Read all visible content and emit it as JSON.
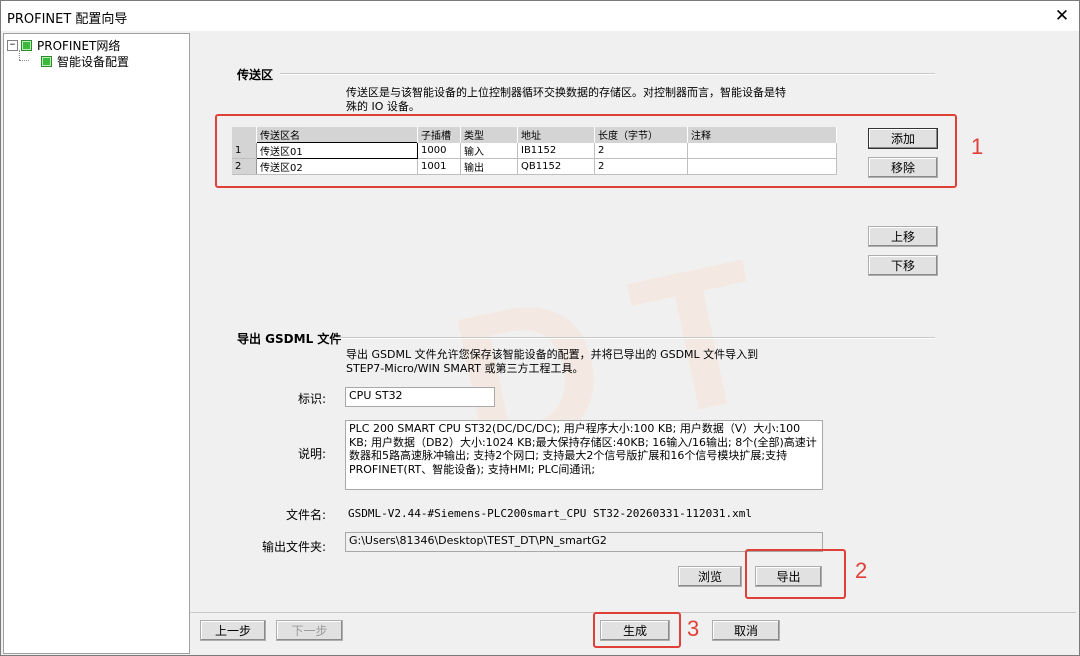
{
  "window": {
    "title": "PROFINET 配置向导",
    "close": "✕"
  },
  "tree": {
    "root": {
      "expander": "−",
      "label": "PROFINET网络"
    },
    "child": {
      "label": "智能设备配置"
    }
  },
  "transfer": {
    "title": "传送区",
    "description_line1": "传送区是与该智能设备的上位控制器循环交换数据的存储区。对控制器而言，智能设备是特",
    "description_line2": "殊的 IO 设备。",
    "columns": [
      "传送区名",
      "子插槽",
      "类型",
      "地址",
      "长度（字节）",
      "注释"
    ],
    "rows": [
      {
        "n": "1",
        "name": "传送区01",
        "slot": "1000",
        "type": "输入",
        "addr": "IB1152",
        "len": "2",
        "note": ""
      },
      {
        "n": "2",
        "name": "传送区02",
        "slot": "1001",
        "type": "输出",
        "addr": "QB1152",
        "len": "2",
        "note": ""
      }
    ],
    "add_label": "添加",
    "remove_label": "移除",
    "up_label": "上移",
    "down_label": "下移"
  },
  "export": {
    "title": "导出 GSDML 文件",
    "description_line1": "导出 GSDML 文件允许您保存该智能设备的配置，并将已导出的 GSDML 文件导入到",
    "description_line2": "STEP7-Micro/WIN SMART 或第三方工程工具。",
    "id_label": "标识:",
    "id_value": "CPU ST32",
    "desc_label": "说明:",
    "desc_value": "PLC 200 SMART CPU ST32(DC/DC/DC); 用户程序大小:100 KB; 用户数据（V）大小:100 KB; 用户数据（DB2）大小:1024 KB;最大保持存储区:40KB; 16输入/16输出; 8个(全部)高速计数器和5路高速脉冲输出; 支持2个网口; 支持最大2个信号版扩展和16个信号模块扩展;支持PROFINET(RT、智能设备); 支持HMI; PLC间通讯;",
    "filename_label": "文件名:",
    "filename_value": "GSDML-V2.44-#Siemens-PLC200smart_CPU ST32-20260331-112031.xml",
    "folder_label": "输出文件夹:",
    "folder_value": "G:\\Users\\81346\\Desktop\\TEST_DT\\PN_smartG2",
    "browse_label": "浏览",
    "export_label": "导出"
  },
  "nav": {
    "prev_label": "上一步",
    "next_label": "下一步",
    "generate_label": "生成",
    "cancel_label": "取消"
  },
  "annotations": {
    "n1": "1",
    "n2": "2",
    "n3": "3"
  },
  "watermark": "DT",
  "colors": {
    "annotation": "#e0403a",
    "tree_node": "#3cb83c"
  }
}
